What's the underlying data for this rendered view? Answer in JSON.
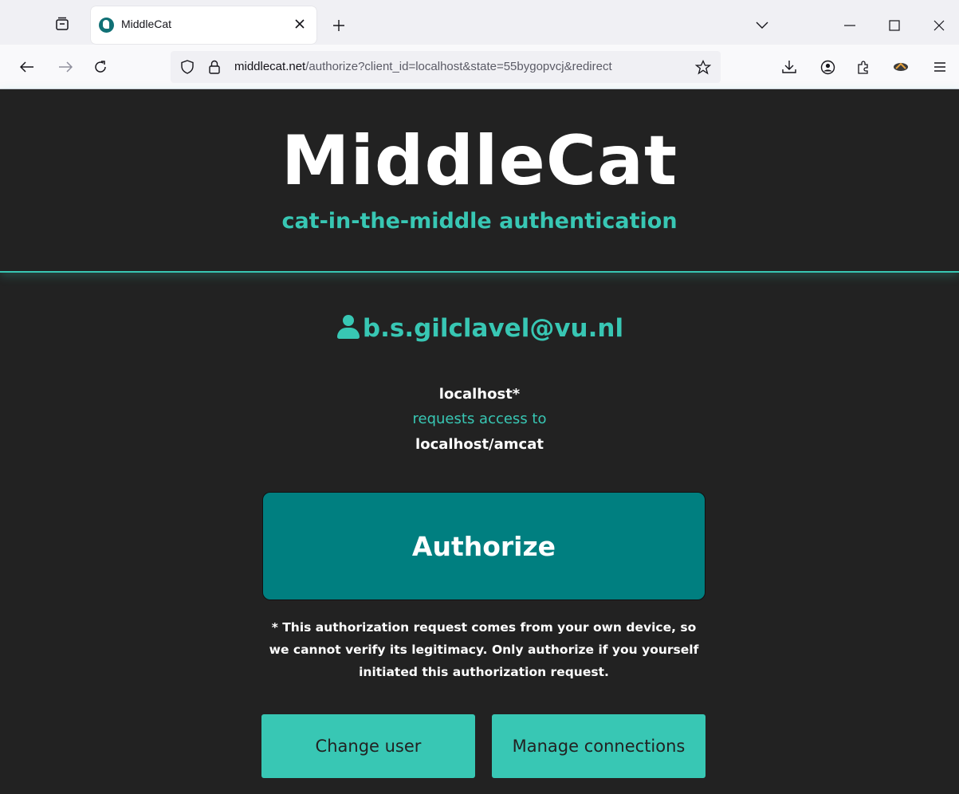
{
  "browser": {
    "tab_title": "MiddleCat",
    "url_host": "middlecat.net",
    "url_path": "/authorize?client_id=localhost&state=55bygopvcj&redirect"
  },
  "header": {
    "brand": "MiddleCat",
    "tagline": "cat-in-the-middle authentication"
  },
  "main": {
    "user_email": "b.s.gilclavel@vu.nl",
    "client": "localhost*",
    "requests_text": "requests access to",
    "resource": "localhost/amcat",
    "authorize_label": "Authorize",
    "note": "* This authorization request comes from your own device, so we cannot verify its legitimacy. Only authorize if you yourself initiated this authorization request.",
    "change_user_label": "Change user",
    "manage_connections_label": "Manage connections"
  },
  "colors": {
    "background": "#222222",
    "accent": "#38c7b4",
    "authorize_bg": "#007f80"
  }
}
